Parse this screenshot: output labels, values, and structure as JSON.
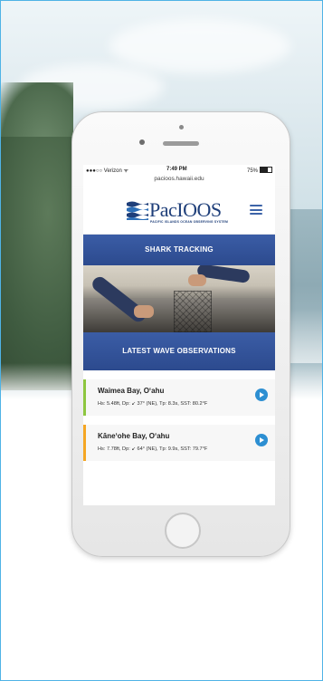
{
  "status_bar": {
    "carrier": "●●●○○ Verizon ᯤ",
    "time": "7:49 PM",
    "battery": "75%"
  },
  "browser": {
    "url": "pacioos.hawaii.edu"
  },
  "header": {
    "logo_text": "PacIOOS",
    "logo_subtitle": "PACIFIC ISLANDS OCEAN OBSERVING SYSTEM"
  },
  "sections": {
    "shark_tracking_label": "SHARK TRACKING",
    "latest_waves_label": "LATEST WAVE OBSERVATIONS"
  },
  "observations": [
    {
      "location": "Waimea Bay, O‘ahu",
      "data": "Hs: 5.48ft, Dp: ↙ 37° (NE), Tp: 8.3s, SST: 80.2°F",
      "accent": "#8dc63f"
    },
    {
      "location": "Kāne‘ohe Bay, O‘ahu",
      "data": "Hs: 7.78ft, Dp: ↙ 64° (NE), Tp: 9.9s, SST: 79.7°F",
      "accent": "#f5a623"
    }
  ],
  "colors": {
    "brand_blue": "#2c4a8e",
    "play_blue": "#2d8fd2",
    "frame_border": "#4fb3e6"
  }
}
